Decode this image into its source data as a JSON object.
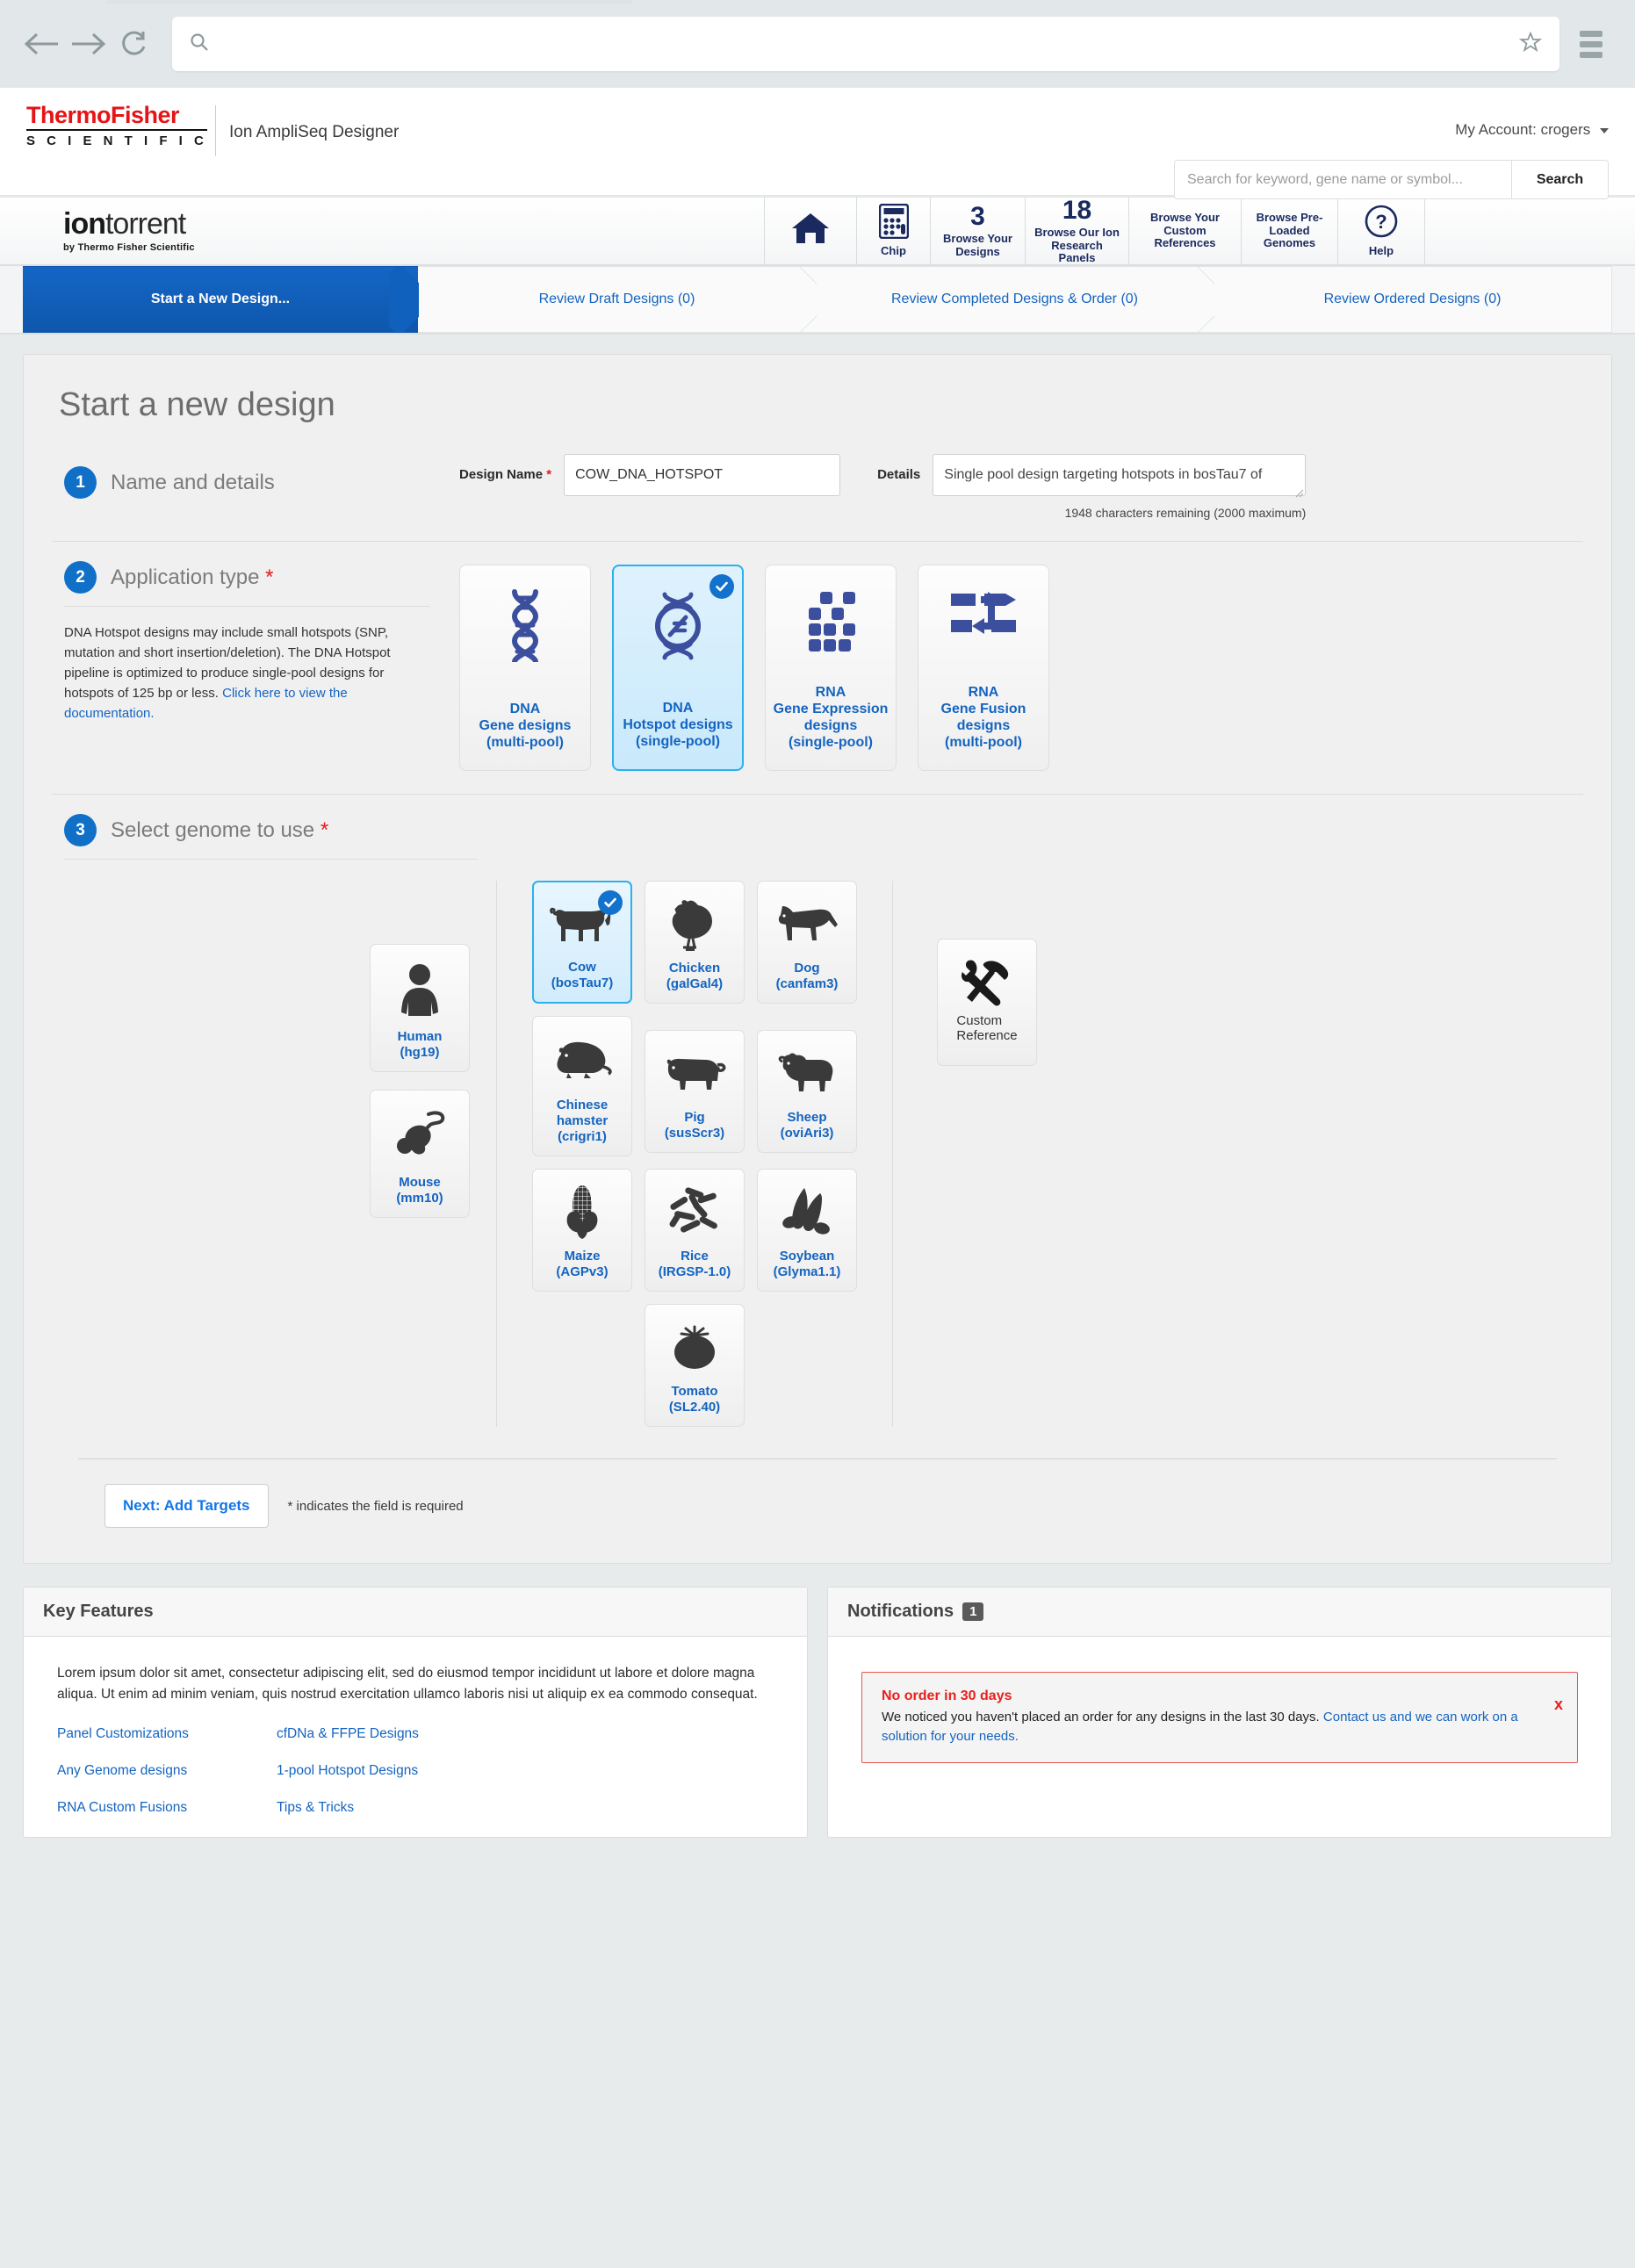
{
  "browser": {
    "back_icon": "back-arrow-icon",
    "forward_icon": "forward-arrow-icon",
    "reload_icon": "reload-icon",
    "url_value": "",
    "bookmark_icon": "star-icon",
    "menu_icon": "hamburger-menu-icon"
  },
  "brand": {
    "logo_top": "ThermoFisher",
    "logo_bottom": "S C I E N T I F I C",
    "app_title": "Ion AmpliSeq Designer",
    "account": "My Account: crogers",
    "ion_logo_bold": "ion",
    "ion_logo_light": "torrent",
    "ion_logo_sub": "by Thermo Fisher Scientific"
  },
  "search": {
    "placeholder": "Search for keyword, gene name or symbol...",
    "value": "",
    "button": "Search"
  },
  "nav": [
    {
      "name": "home",
      "icon": "home-icon",
      "label": ""
    },
    {
      "name": "chip",
      "icon": "calculator-chip-icon",
      "label": "Chip"
    },
    {
      "name": "browse-designs",
      "count": "3",
      "label": "Browse Your Designs"
    },
    {
      "name": "browse-panels",
      "count": "18",
      "label": "Browse Our Ion Research Panels"
    },
    {
      "name": "custom-references",
      "label": "Browse  Your Custom References"
    },
    {
      "name": "preloaded-genomes",
      "label": "Browse Pre-Loaded Genomes"
    },
    {
      "name": "help",
      "icon": "question-mark-icon",
      "label": "Help"
    }
  ],
  "steps": [
    {
      "label": "Start a New Design...",
      "active": true
    },
    {
      "label": "Review Draft Designs (0)",
      "active": false
    },
    {
      "label": "Review Completed Designs & Order (0)",
      "active": false
    },
    {
      "label": "Review Ordered Designs (0)",
      "active": false
    }
  ],
  "page": {
    "title": "Start a new design"
  },
  "section1": {
    "num": "1",
    "title": "Name and details",
    "design_name_label": "Design Name",
    "design_name_value": "COW_DNA_HOTSPOT",
    "details_label": "Details",
    "details_value": "Single pool design targeting hotspots in bosTau7 of",
    "char_count": "1948 characters remaining (2000 maximum)"
  },
  "section2": {
    "num": "2",
    "title": "Application type",
    "description": "DNA Hotspot designs may include small hotspots (SNP, mutation and short insertion/deletion). The DNA Hotspot pipeline is optimized to produce single-pool designs for hotspots of 125 bp or less.",
    "doc_link": "Click here to view the documentation.",
    "cards": [
      {
        "line1": "DNA",
        "line2": "Gene designs",
        "line3": "(multi-pool)",
        "icon": "dna-helix-icon",
        "selected": false
      },
      {
        "line1": "DNA",
        "line2": "Hotspot designs",
        "line3": "(single-pool)",
        "icon": "dna-hotspot-icon",
        "selected": true
      },
      {
        "line1": "RNA",
        "line2": "Gene Expression",
        "line3": "designs",
        "line4": "(single-pool)",
        "icon": "gene-expression-grid-icon",
        "selected": false
      },
      {
        "line1": "RNA",
        "line2": "Gene Fusion",
        "line3": "designs",
        "line4": "(multi-pool)",
        "icon": "gene-fusion-icon",
        "selected": false
      }
    ]
  },
  "section3": {
    "num": "3",
    "title": "Select genome to use",
    "common": [
      {
        "name": "Human",
        "build": "(hg19)",
        "icon": "human-icon",
        "selected": false
      },
      {
        "name": "Mouse",
        "build": "(mm10)",
        "icon": "mouse-icon",
        "selected": false
      }
    ],
    "grid": [
      [
        {
          "name": "Cow",
          "build": "(bosTau7)",
          "icon": "cow-icon",
          "selected": true
        },
        {
          "name": "Chicken",
          "build": "(galGal4)",
          "icon": "chicken-icon",
          "selected": false
        },
        {
          "name": "Dog",
          "build": "(canfam3)",
          "icon": "dog-icon",
          "selected": false
        }
      ],
      [
        {
          "name": "Chinese hamster",
          "build": "(crigri1)",
          "icon": "hamster-icon",
          "selected": false
        },
        {
          "name": "Pig",
          "build": "(susScr3)",
          "icon": "pig-icon",
          "selected": false
        },
        {
          "name": "Sheep",
          "build": "(oviAri3)",
          "icon": "sheep-icon",
          "selected": false
        }
      ],
      [
        {
          "name": "Maize",
          "build": "(AGPv3)",
          "icon": "maize-icon",
          "selected": false
        },
        {
          "name": "Rice",
          "build": "(IRGSP-1.0)",
          "icon": "rice-icon",
          "selected": false
        },
        {
          "name": "Soybean",
          "build": "(Glyma1.1)",
          "icon": "soybean-icon",
          "selected": false
        }
      ],
      [
        {
          "name": "",
          "build": "",
          "icon": "",
          "spacer": true
        },
        {
          "name": "Tomato",
          "build": "(SL2.40)",
          "icon": "tomato-icon",
          "selected": false
        },
        {
          "name": "",
          "build": "",
          "icon": "",
          "spacer": true
        }
      ]
    ],
    "custom": {
      "line1": "Custom",
      "line2": "Reference",
      "icon": "hammer-wrench-icon"
    }
  },
  "footer": {
    "next_button": "Next: Add Targets",
    "required_note": "* indicates the field is required"
  },
  "key_features": {
    "title": "Key Features",
    "body": "Lorem ipsum dolor sit amet, consectetur adipiscing elit, sed do eiusmod tempor incididunt ut labore et dolore magna aliqua. Ut enim ad minim veniam, quis nostrud exercitation ullamco laboris nisi ut aliquip ex ea commodo consequat.",
    "links_left": [
      "Panel Customizations",
      "Any Genome designs",
      "RNA Custom Fusions"
    ],
    "links_right": [
      "cfDNa & FFPE Designs",
      "1-pool Hotspot Designs",
      "Tips & Tricks"
    ]
  },
  "notifications": {
    "title": "Notifications",
    "count": "1",
    "alert_title": "No order in 30 days",
    "alert_body_1": "We noticed you haven't placed an order for any designs in the last 30 days. ",
    "alert_link": "Contact us and we can work on a solution for your needs.",
    "close_label": "x"
  },
  "colors": {
    "brand_red": "#e71316",
    "navy": "#1b2a5e",
    "accent_blue": "#1464c0",
    "step_blue": "#1070c8",
    "selected_border": "#2bb0f0",
    "alert_red": "#e8201c"
  }
}
